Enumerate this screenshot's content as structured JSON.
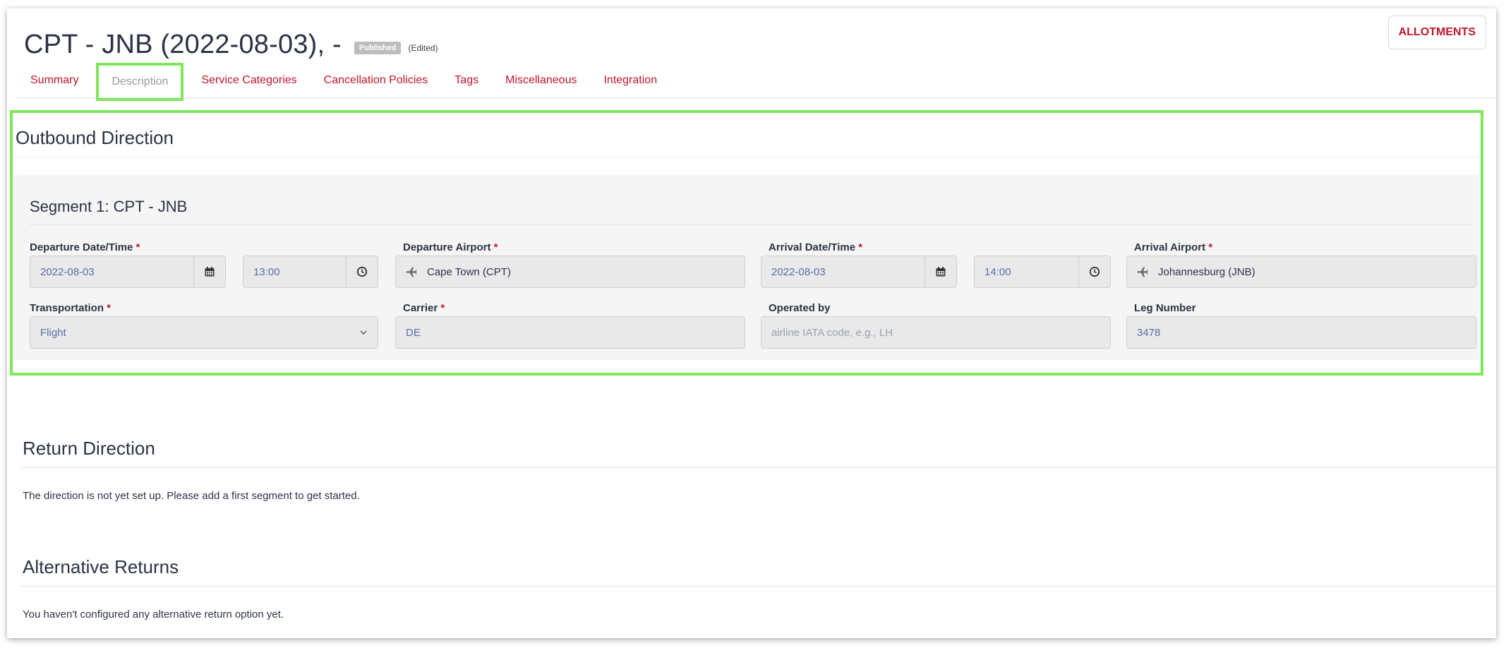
{
  "header": {
    "title": "CPT - JNB (2022-08-03), -",
    "status_badge": "Published",
    "edited_label": "(Edited)",
    "allotments_button": "ALLOTMENTS"
  },
  "tabs": [
    {
      "label": "Summary",
      "active": false
    },
    {
      "label": "Description",
      "active": true
    },
    {
      "label": "Service Categories",
      "active": false
    },
    {
      "label": "Cancellation Policies",
      "active": false
    },
    {
      "label": "Tags",
      "active": false
    },
    {
      "label": "Miscellaneous",
      "active": false
    },
    {
      "label": "Integration",
      "active": false
    }
  ],
  "outbound": {
    "heading": "Outbound Direction",
    "segment_title": "Segment 1: CPT - JNB",
    "departure_datetime": {
      "label": "Departure Date/Time",
      "date": "2022-08-03",
      "time": "13:00"
    },
    "departure_airport": {
      "label": "Departure Airport",
      "value": "Cape Town (CPT)"
    },
    "arrival_datetime": {
      "label": "Arrival Date/Time",
      "date": "2022-08-03",
      "time": "14:00"
    },
    "arrival_airport": {
      "label": "Arrival Airport",
      "value": "Johannesburg (JNB)"
    },
    "transportation": {
      "label": "Transportation",
      "value": "Flight"
    },
    "carrier": {
      "label": "Carrier",
      "value": "DE"
    },
    "operated_by": {
      "label": "Operated by",
      "placeholder": "airline IATA code, e.g., LH"
    },
    "leg_number": {
      "label": "Leg Number",
      "value": "3478"
    },
    "required_marker": "*"
  },
  "return_direction": {
    "heading": "Return Direction",
    "message": "The direction is not yet set up. Please add a first segment to get started."
  },
  "alternative_returns": {
    "heading": "Alternative Returns",
    "message": "You haven't configured any alternative return option yet."
  },
  "colors": {
    "accent": "#c0162a",
    "highlight": "#7ee85a"
  }
}
